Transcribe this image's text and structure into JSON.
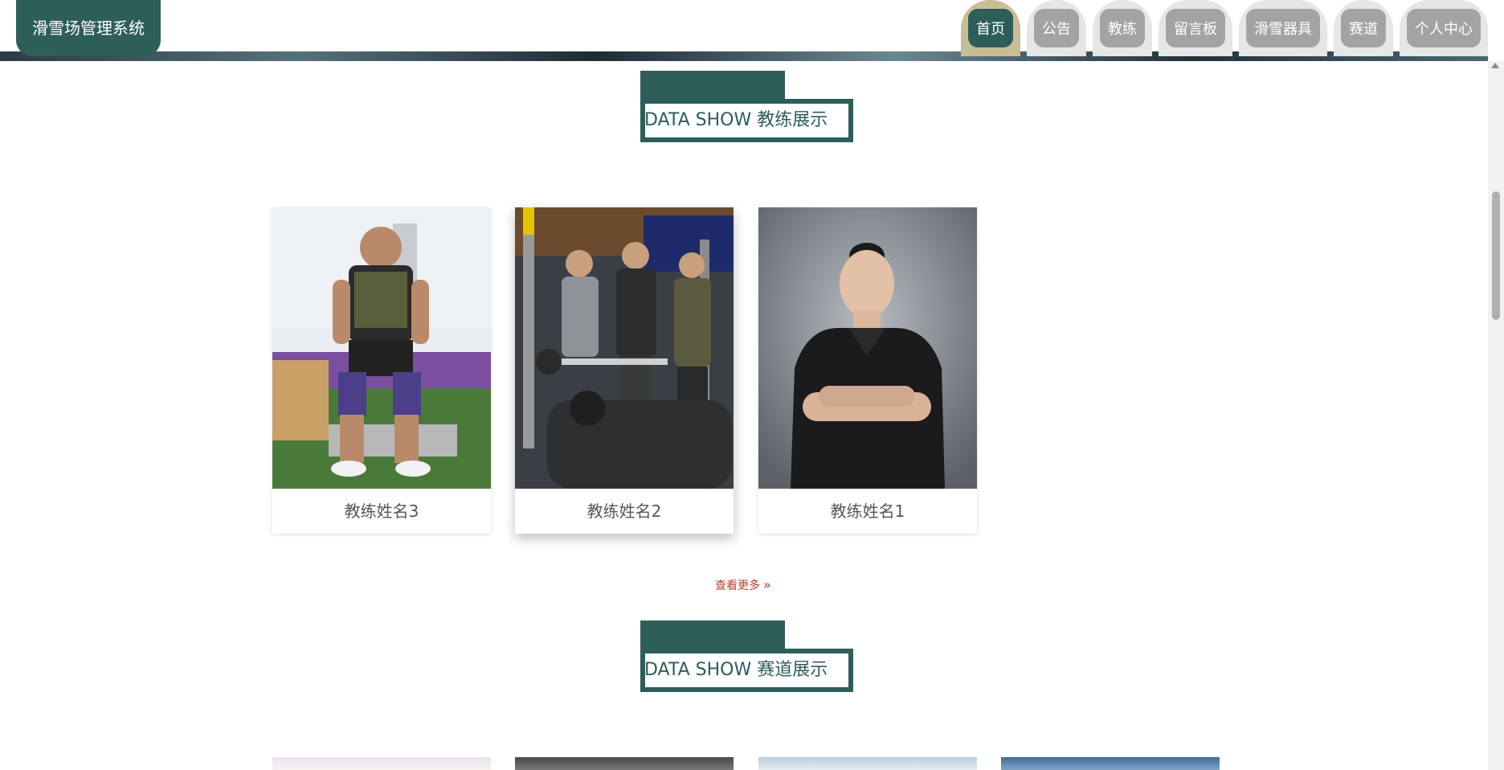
{
  "header": {
    "brand": "滑雪场管理系统",
    "nav": [
      {
        "label": "首页",
        "active": true
      },
      {
        "label": "公告",
        "active": false
      },
      {
        "label": "教练",
        "active": false
      },
      {
        "label": "留言板",
        "active": false
      },
      {
        "label": "滑雪器具",
        "active": false
      },
      {
        "label": "赛道",
        "active": false
      },
      {
        "label": "个人中心",
        "active": false
      }
    ]
  },
  "coach_section": {
    "title": "DATA SHOW 教练展示",
    "cards": [
      {
        "name": "教练姓名3"
      },
      {
        "name": "教练姓名2"
      },
      {
        "name": "教练姓名1"
      }
    ],
    "more": "查看更多"
  },
  "track_section": {
    "title": "DATA SHOW 赛道展示"
  },
  "colors": {
    "primary": "#2d5e5a",
    "nav_inactive": "#a3a3a3",
    "nav_active_ring": "#c8be95",
    "more_link": "#b2422d"
  }
}
